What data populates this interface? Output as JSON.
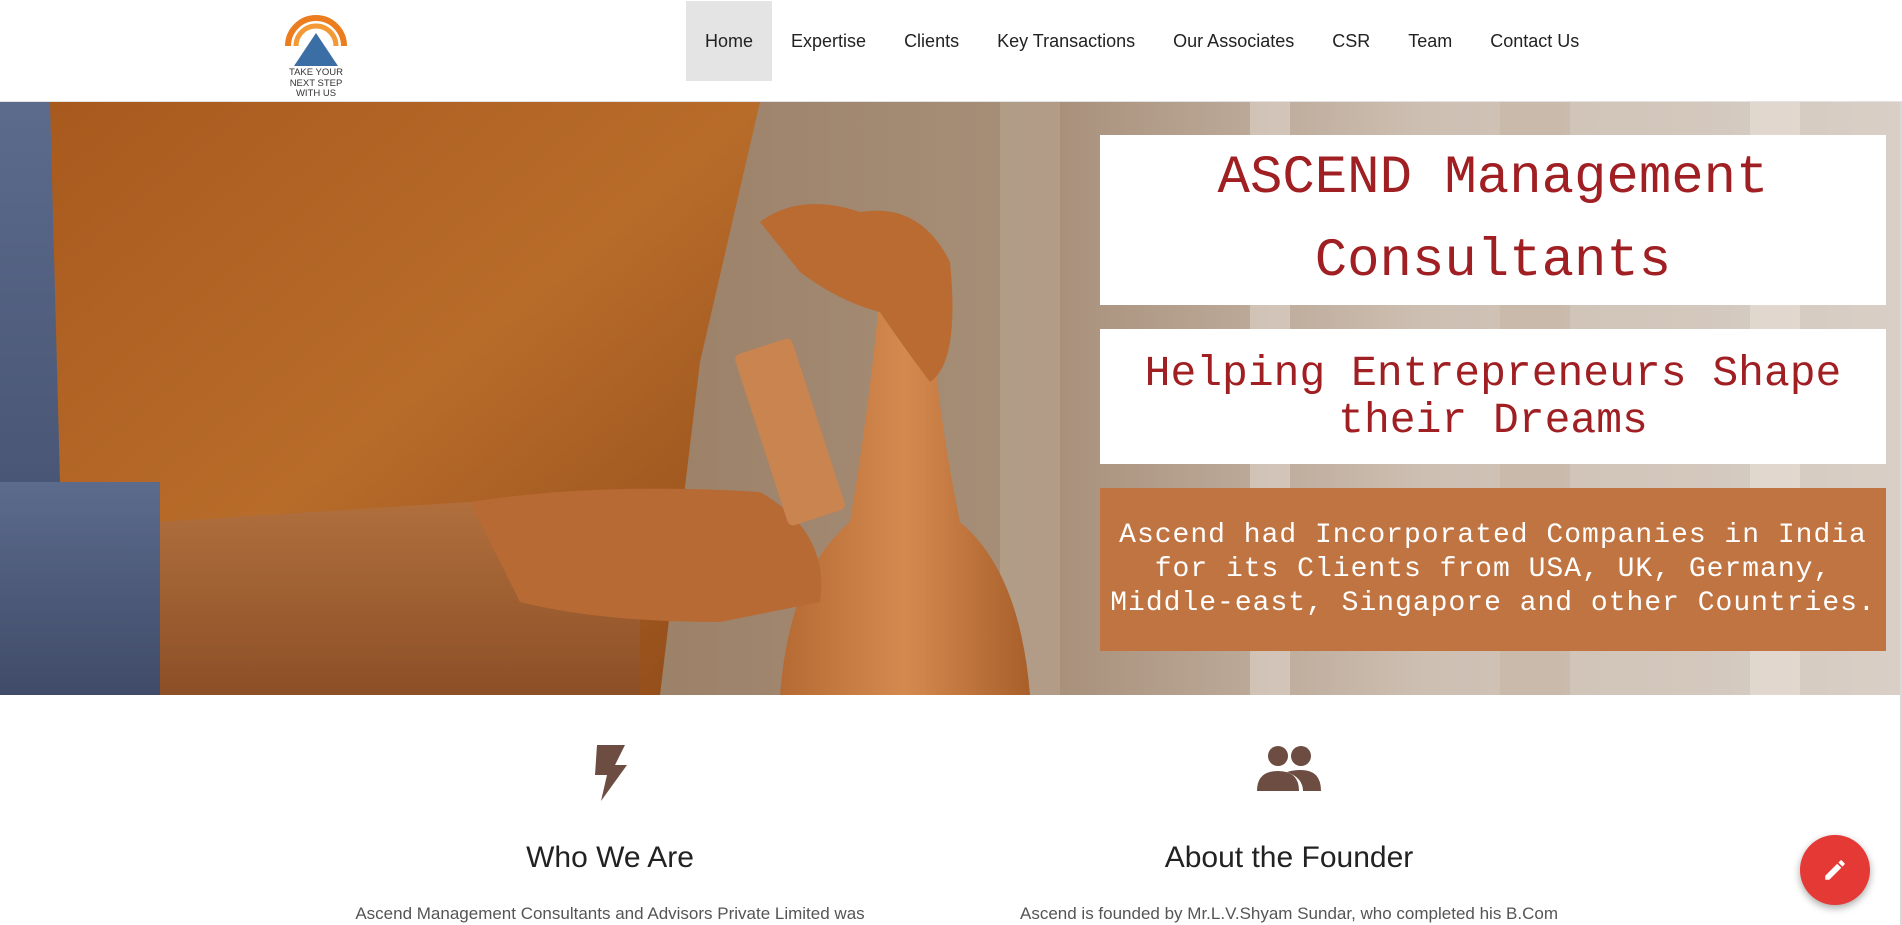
{
  "logo": {
    "tagline": [
      "TAKE YOUR",
      "NEXT STEP",
      "WITH US"
    ]
  },
  "nav": {
    "items": [
      "Home",
      "Expertise",
      "Clients",
      "Key Transactions",
      "Our Associates",
      "CSR",
      "Team",
      "Contact Us"
    ],
    "active": "Home"
  },
  "hero": {
    "title_line1": "ASCEND Management",
    "title_line2": "Consultants",
    "subtitle": "Helping Entrepreneurs Shape their Dreams",
    "info": "Ascend had Incorporated Companies in India for its Clients from USA, UK, Germany, Middle-east, Singapore and other Countries."
  },
  "features": [
    {
      "icon": "lightning-bolt-icon",
      "title": "Who We Are",
      "text": "Ascend Management Consultants and Advisors Private Limited was"
    },
    {
      "icon": "people-group-icon",
      "title": "About the Founder",
      "text": "Ascend is founded by Mr.L.V.Shyam Sundar, who completed his B.Com"
    }
  ],
  "fab": {
    "icon": "pencil-edit-icon"
  },
  "colors": {
    "brand_red": "#a01f23",
    "terracotta": "#c07441",
    "icon_brown": "#6d4c41",
    "fab_red": "#e53935",
    "nav_active_bg": "#e4e4e4"
  }
}
